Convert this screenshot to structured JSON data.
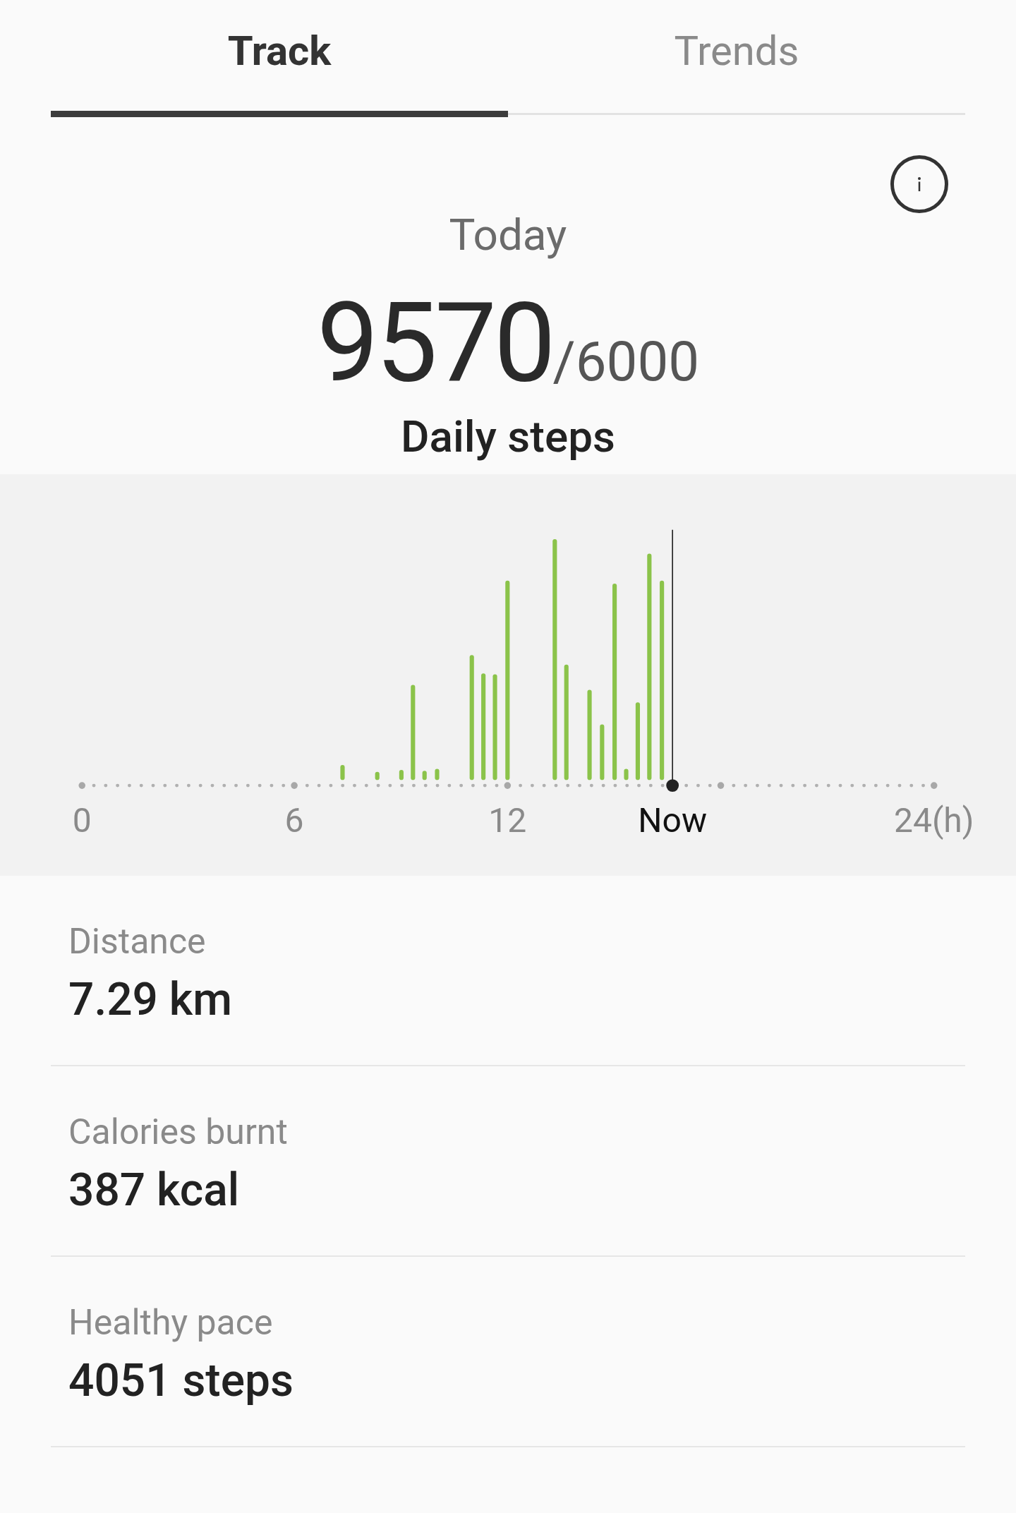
{
  "tabs": [
    {
      "label": "Track",
      "selected": true
    },
    {
      "label": "Trends",
      "selected": false
    }
  ],
  "summary": {
    "period": "Today",
    "steps": "9570",
    "goal": "/6000",
    "caption": "Daily steps"
  },
  "axis_labels": [
    {
      "text": "0",
      "current": false
    },
    {
      "text": "6",
      "current": false
    },
    {
      "text": "12",
      "current": false
    },
    {
      "text": "Now",
      "current": true
    },
    {
      "text": "24(h)",
      "current": false
    }
  ],
  "stats": [
    {
      "label": "Distance",
      "value": "7.29 km"
    },
    {
      "label": "Calories burnt",
      "value": "387 kcal"
    },
    {
      "label": "Healthy pace",
      "value": "4051 steps"
    }
  ]
}
